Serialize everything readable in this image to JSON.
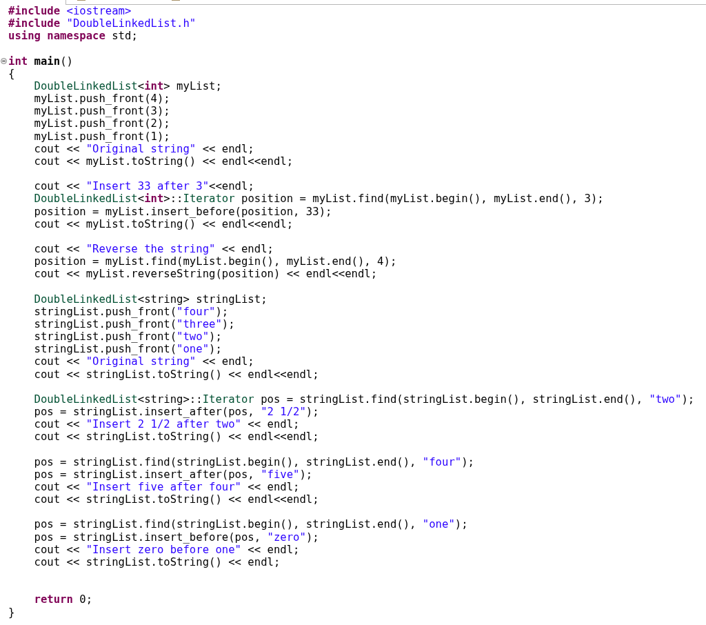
{
  "lines": [
    {
      "kind": "code",
      "tokens": [
        {
          "kind": "keyword",
          "text": "#include"
        },
        {
          "kind": "string",
          "text": " <iostream>"
        }
      ]
    },
    {
      "kind": "code",
      "tokens": [
        {
          "kind": "keyword",
          "text": "#include"
        },
        {
          "kind": "string",
          "text": " \"DoubleLinkedList.h\""
        }
      ]
    },
    {
      "kind": "code",
      "tokens": [
        {
          "kind": "keyword",
          "text": "using namespace"
        },
        {
          "kind": "plain",
          "text": " std;"
        }
      ]
    },
    {
      "kind": "blank"
    },
    {
      "kind": "code",
      "fold": {
        "expanded": true
      },
      "tokens": [
        {
          "kind": "keyword",
          "text": "int"
        },
        {
          "kind": "bold",
          "text": " main"
        },
        {
          "kind": "plain",
          "text": "()"
        }
      ]
    },
    {
      "kind": "code",
      "tokens": [
        {
          "kind": "plain",
          "text": "{"
        }
      ],
      "children": [
        {
          "kind": "code",
          "tokens": [
            {
              "kind": "type",
              "text": "DoubleLinkedList"
            },
            {
              "kind": "plain",
              "text": "<"
            },
            {
              "kind": "keyword",
              "text": "int"
            },
            {
              "kind": "plain",
              "text": "> myList;"
            }
          ]
        },
        {
          "kind": "code",
          "tokens": [
            {
              "kind": "plain",
              "text": "myList.push_front(4);"
            }
          ]
        },
        {
          "kind": "code",
          "tokens": [
            {
              "kind": "plain",
              "text": "myList.push_front(3);"
            }
          ]
        },
        {
          "kind": "code",
          "tokens": [
            {
              "kind": "plain",
              "text": "myList.push_front(2);"
            }
          ]
        },
        {
          "kind": "code",
          "tokens": [
            {
              "kind": "plain",
              "text": "myList.push_front(1);"
            }
          ]
        },
        {
          "kind": "code",
          "tokens": [
            {
              "kind": "plain",
              "text": "cout << "
            },
            {
              "kind": "string",
              "text": "\"Original string\""
            },
            {
              "kind": "plain",
              "text": " << endl;"
            }
          ]
        },
        {
          "kind": "code",
          "tokens": [
            {
              "kind": "plain",
              "text": "cout << myList.toString() << endl<<endl;"
            }
          ]
        },
        {
          "kind": "blank"
        },
        {
          "kind": "code",
          "tokens": [
            {
              "kind": "plain",
              "text": "cout << "
            },
            {
              "kind": "string",
              "text": "\"Insert 33 after 3\""
            },
            {
              "kind": "plain",
              "text": "<<endl;"
            }
          ]
        },
        {
          "kind": "code",
          "tokens": [
            {
              "kind": "type",
              "text": "DoubleLinkedList"
            },
            {
              "kind": "plain",
              "text": "<"
            },
            {
              "kind": "keyword",
              "text": "int"
            },
            {
              "kind": "plain",
              "text": ">::"
            },
            {
              "kind": "type",
              "text": "Iterator"
            },
            {
              "kind": "plain",
              "text": " position = myList.find(myList.begin(), myList.end(), 3);"
            }
          ]
        },
        {
          "kind": "code",
          "tokens": [
            {
              "kind": "plain",
              "text": "position = myList.insert_before(position, 33);"
            }
          ]
        },
        {
          "kind": "code",
          "tokens": [
            {
              "kind": "plain",
              "text": "cout << myList.toString() << endl<<endl;"
            }
          ]
        },
        {
          "kind": "blank"
        },
        {
          "kind": "code",
          "tokens": [
            {
              "kind": "plain",
              "text": "cout << "
            },
            {
              "kind": "string",
              "text": "\"Reverse the string\""
            },
            {
              "kind": "plain",
              "text": " << endl;"
            }
          ]
        },
        {
          "kind": "code",
          "tokens": [
            {
              "kind": "plain",
              "text": "position = myList.find(myList.begin(), myList.end(), 4);"
            }
          ]
        },
        {
          "kind": "code",
          "tokens": [
            {
              "kind": "plain",
              "text": "cout << myList.reverseString(position) << endl<<endl;"
            }
          ]
        },
        {
          "kind": "blank"
        },
        {
          "kind": "code",
          "tokens": [
            {
              "kind": "type",
              "text": "DoubleLinkedList"
            },
            {
              "kind": "plain",
              "text": "<string> stringList;"
            }
          ]
        },
        {
          "kind": "code",
          "tokens": [
            {
              "kind": "plain",
              "text": "stringList.push_front("
            },
            {
              "kind": "string",
              "text": "\"four\""
            },
            {
              "kind": "plain",
              "text": ");"
            }
          ]
        },
        {
          "kind": "code",
          "tokens": [
            {
              "kind": "plain",
              "text": "stringList.push_front("
            },
            {
              "kind": "string",
              "text": "\"three\""
            },
            {
              "kind": "plain",
              "text": ");"
            }
          ]
        },
        {
          "kind": "code",
          "tokens": [
            {
              "kind": "plain",
              "text": "stringList.push_front("
            },
            {
              "kind": "string",
              "text": "\"two\""
            },
            {
              "kind": "plain",
              "text": ");"
            }
          ]
        },
        {
          "kind": "code",
          "tokens": [
            {
              "kind": "plain",
              "text": "stringList.push_front("
            },
            {
              "kind": "string",
              "text": "\"one\""
            },
            {
              "kind": "plain",
              "text": ");"
            }
          ]
        },
        {
          "kind": "code",
          "tokens": [
            {
              "kind": "plain",
              "text": "cout << "
            },
            {
              "kind": "string",
              "text": "\"Original string\""
            },
            {
              "kind": "plain",
              "text": " << endl;"
            }
          ]
        },
        {
          "kind": "code",
          "tokens": [
            {
              "kind": "plain",
              "text": "cout << stringList.toString() << endl<<endl;"
            }
          ]
        },
        {
          "kind": "blank"
        },
        {
          "kind": "code",
          "tokens": [
            {
              "kind": "type",
              "text": "DoubleLinkedList"
            },
            {
              "kind": "plain",
              "text": "<string>::"
            },
            {
              "kind": "type",
              "text": "Iterator"
            },
            {
              "kind": "plain",
              "text": " pos = stringList.find(stringList.begin(), stringList.end(), "
            },
            {
              "kind": "string",
              "text": "\"two\""
            },
            {
              "kind": "plain",
              "text": ");"
            }
          ]
        },
        {
          "kind": "code",
          "tokens": [
            {
              "kind": "plain",
              "text": "pos = stringList.insert_after(pos, "
            },
            {
              "kind": "string",
              "text": "\"2 1/2\""
            },
            {
              "kind": "plain",
              "text": ");"
            }
          ]
        },
        {
          "kind": "code",
          "tokens": [
            {
              "kind": "plain",
              "text": "cout << "
            },
            {
              "kind": "string",
              "text": "\"Insert 2 1/2 after two\""
            },
            {
              "kind": "plain",
              "text": " << endl;"
            }
          ]
        },
        {
          "kind": "code",
          "tokens": [
            {
              "kind": "plain",
              "text": "cout << stringList.toString() << endl<<endl;"
            }
          ]
        },
        {
          "kind": "blank"
        },
        {
          "kind": "code",
          "tokens": [
            {
              "kind": "plain",
              "text": "pos = stringList.find(stringList.begin(), stringList.end(), "
            },
            {
              "kind": "string",
              "text": "\"four\""
            },
            {
              "kind": "plain",
              "text": ");"
            }
          ]
        },
        {
          "kind": "code",
          "tokens": [
            {
              "kind": "plain",
              "text": "pos = stringList.insert_after(pos, "
            },
            {
              "kind": "string",
              "text": "\"five\""
            },
            {
              "kind": "plain",
              "text": ");"
            }
          ]
        },
        {
          "kind": "code",
          "tokens": [
            {
              "kind": "plain",
              "text": "cout << "
            },
            {
              "kind": "string",
              "text": "\"Insert five after four\""
            },
            {
              "kind": "plain",
              "text": " << endl;"
            }
          ]
        },
        {
          "kind": "code",
          "tokens": [
            {
              "kind": "plain",
              "text": "cout << stringList.toString() << endl<<endl;"
            }
          ]
        },
        {
          "kind": "blank"
        },
        {
          "kind": "code",
          "tokens": [
            {
              "kind": "plain",
              "text": "pos = stringList.find(stringList.begin(), stringList.end(), "
            },
            {
              "kind": "string",
              "text": "\"one\""
            },
            {
              "kind": "plain",
              "text": ");"
            }
          ]
        },
        {
          "kind": "code",
          "tokens": [
            {
              "kind": "plain",
              "text": "pos = stringList.insert_before(pos, "
            },
            {
              "kind": "string",
              "text": "\"zero\""
            },
            {
              "kind": "plain",
              "text": ");"
            }
          ]
        },
        {
          "kind": "code",
          "tokens": [
            {
              "kind": "plain",
              "text": "cout << "
            },
            {
              "kind": "string",
              "text": "\"Insert zero before one\""
            },
            {
              "kind": "plain",
              "text": " << endl;"
            }
          ]
        },
        {
          "kind": "code",
          "tokens": [
            {
              "kind": "plain",
              "text": "cout << stringList.toString() << endl;"
            }
          ]
        },
        {
          "kind": "blank"
        },
        {
          "kind": "blank"
        },
        {
          "kind": "code",
          "tokens": [
            {
              "kind": "keyword",
              "text": "return"
            },
            {
              "kind": "plain",
              "text": " 0;"
            }
          ]
        }
      ]
    },
    {
      "kind": "code",
      "tokens": [
        {
          "kind": "plain",
          "text": "}"
        }
      ]
    }
  ]
}
